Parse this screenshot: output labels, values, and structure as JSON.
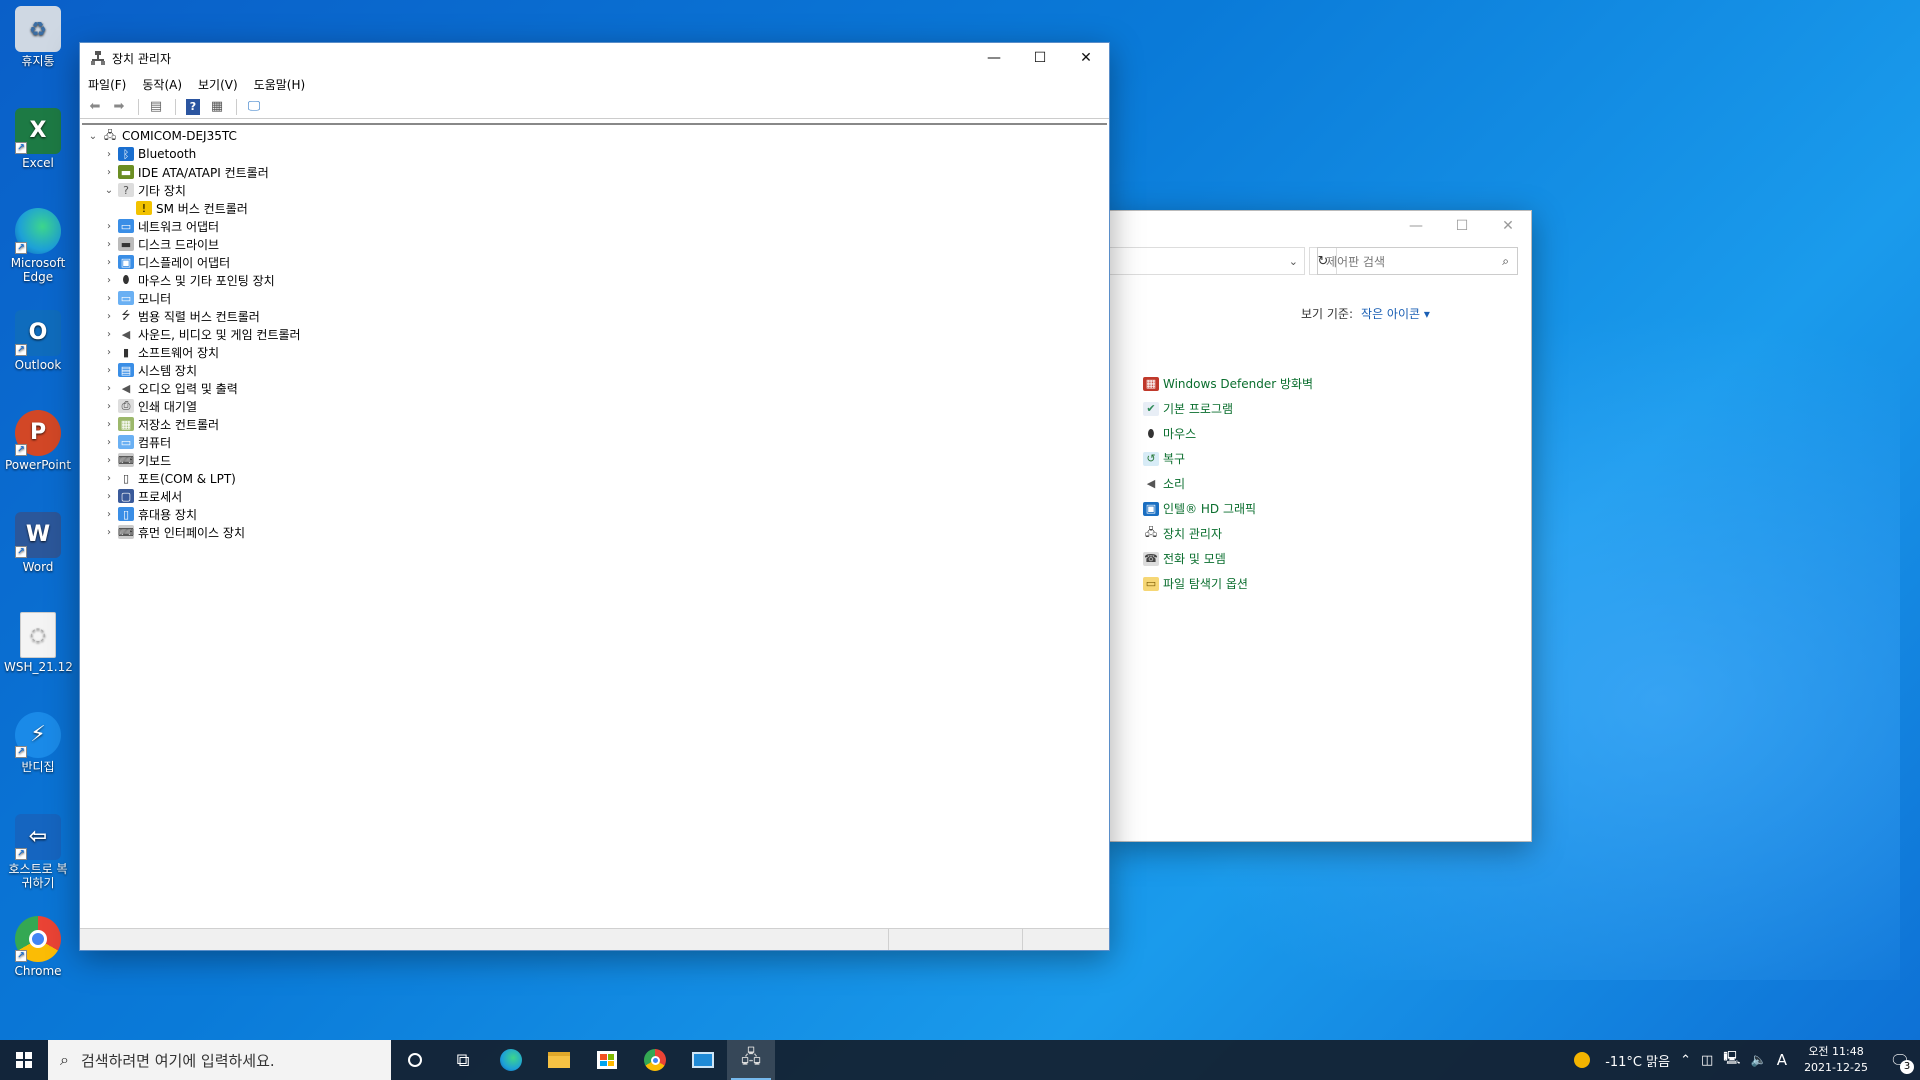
{
  "desktop": {
    "icons": [
      {
        "label": "휴지통",
        "icon": "recycle-bin-icon",
        "color": "#cfd8e3"
      },
      {
        "label": "Excel",
        "icon": "excel-icon",
        "color": "#1d7a44"
      },
      {
        "label": "Microsoft Edge",
        "icon": "edge-icon",
        "color": "#1da0d8"
      },
      {
        "label": "Outlook",
        "icon": "outlook-icon",
        "color": "#0f6cbd"
      },
      {
        "label": "PowerPoint",
        "icon": "powerpoint-icon",
        "color": "#d24726"
      },
      {
        "label": "Word",
        "icon": "word-icon",
        "color": "#2b579a"
      },
      {
        "label": "WSH_21.12",
        "icon": "file-icon",
        "color": "#f4f4f4"
      },
      {
        "label": "반디집",
        "icon": "bandizip-icon",
        "color": "#1a8ae8"
      },
      {
        "label": "호스트로 복귀하기",
        "icon": "host-return-icon",
        "color": "#1565c0"
      },
      {
        "label": "Chrome",
        "icon": "chrome-icon",
        "color": "#e8eaed"
      }
    ]
  },
  "device_manager": {
    "title": "장치 관리자",
    "menu": [
      "파일(F)",
      "동작(A)",
      "보기(V)",
      "도움말(H)"
    ],
    "root": "COMICOM-DEJ35TC",
    "nodes": [
      {
        "label": "Bluetooth",
        "expanded": false,
        "icon": "bluetooth-icon"
      },
      {
        "label": "IDE ATA/ATAPI 컨트롤러",
        "expanded": false,
        "icon": "ide-controller-icon"
      },
      {
        "label": "기타 장치",
        "expanded": true,
        "icon": "other-devices-icon"
      },
      {
        "label": "SM 버스 컨트롤러",
        "child": true,
        "icon": "warning-device-icon"
      },
      {
        "label": "네트워크 어댑터",
        "expanded": false,
        "icon": "network-adapter-icon"
      },
      {
        "label": "디스크 드라이브",
        "expanded": false,
        "icon": "disk-drive-icon"
      },
      {
        "label": "디스플레이 어댑터",
        "expanded": false,
        "icon": "display-adapter-icon"
      },
      {
        "label": "마우스 및 기타 포인팅 장치",
        "expanded": false,
        "icon": "mouse-icon"
      },
      {
        "label": "모니터",
        "expanded": false,
        "icon": "monitor-icon"
      },
      {
        "label": "범용 직렬 버스 컨트롤러",
        "expanded": false,
        "icon": "usb-icon"
      },
      {
        "label": "사운드, 비디오 및 게임 컨트롤러",
        "expanded": false,
        "icon": "sound-icon"
      },
      {
        "label": "소프트웨어 장치",
        "expanded": false,
        "icon": "software-device-icon"
      },
      {
        "label": "시스템 장치",
        "expanded": false,
        "icon": "system-device-icon"
      },
      {
        "label": "오디오 입력 및 출력",
        "expanded": false,
        "icon": "audio-io-icon"
      },
      {
        "label": "인쇄 대기열",
        "expanded": false,
        "icon": "print-queue-icon"
      },
      {
        "label": "저장소 컨트롤러",
        "expanded": false,
        "icon": "storage-controller-icon"
      },
      {
        "label": "컴퓨터",
        "expanded": false,
        "icon": "computer-icon"
      },
      {
        "label": "키보드",
        "expanded": false,
        "icon": "keyboard-icon"
      },
      {
        "label": "포트(COM & LPT)",
        "expanded": false,
        "icon": "port-icon"
      },
      {
        "label": "프로세서",
        "expanded": false,
        "icon": "processor-icon"
      },
      {
        "label": "휴대용 장치",
        "expanded": false,
        "icon": "portable-device-icon"
      },
      {
        "label": "휴먼 인터페이스 장치",
        "expanded": false,
        "icon": "hid-icon"
      }
    ]
  },
  "control_panel": {
    "search_placeholder": "제어판 검색",
    "view_label": "보기 기준:",
    "view_value": "작은 아이콘 ▾",
    "items": [
      {
        "label": "Windows Defender 방화벽",
        "icon": "firewall-icon"
      },
      {
        "label": "기본 프로그램",
        "icon": "default-programs-icon"
      },
      {
        "label": "마우스",
        "icon": "mouse-icon"
      },
      {
        "label": "복구",
        "icon": "recovery-icon"
      },
      {
        "label": "소리",
        "icon": "sound-icon"
      },
      {
        "label": "인텔® HD 그래픽",
        "icon": "intel-graphics-icon"
      },
      {
        "label": "장치 관리자",
        "icon": "device-manager-icon"
      },
      {
        "label": "전화 및 모뎀",
        "icon": "phone-modem-icon"
      },
      {
        "label": "파일 탐색기 옵션",
        "icon": "folder-options-icon"
      }
    ]
  },
  "taskbar": {
    "search_placeholder": "검색하려면 여기에 입력하세요.",
    "apps": [
      "cortana-icon",
      "task-view-icon",
      "edge-icon",
      "file-explorer-icon",
      "store-icon",
      "chrome-icon",
      "remote-desktop-icon",
      "device-manager-icon"
    ],
    "weather": "-11°C 맑음",
    "ime": "A",
    "time": "오전 11:48",
    "date": "2021-12-25",
    "notification_count": "3"
  }
}
